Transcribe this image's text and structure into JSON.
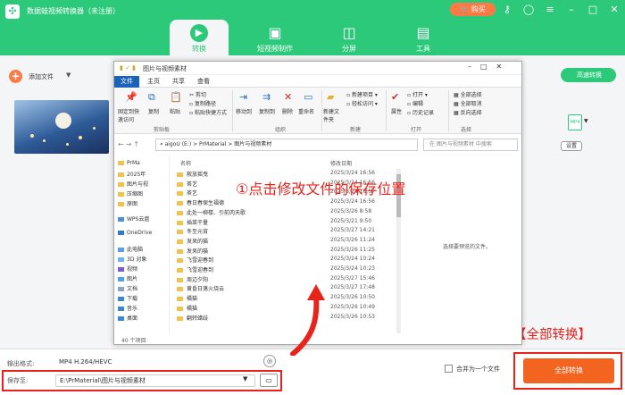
{
  "app": {
    "title": "数据蛙视频转换器（未注册）",
    "buy": "购买"
  },
  "nav": {
    "tabs": [
      {
        "label": "转换"
      },
      {
        "label": "短视频制作"
      },
      {
        "label": "分屏"
      },
      {
        "label": "工具"
      }
    ]
  },
  "toolbar": {
    "add_file": "添加文件",
    "hw_accel": "高速转换"
  },
  "item": {
    "format_badge": "MP4",
    "setting": "设置"
  },
  "bottom": {
    "format_label": "输出格式:",
    "format_value": "MP4 H.264/HEVC",
    "save_label": "保存至:",
    "save_path": "E:\\PrMaterial\\图片与视频素材",
    "merge": "合并为一个文件",
    "convert_all": "全部转换"
  },
  "dialog": {
    "title": "图片与视频素材",
    "tabs": [
      "文件",
      "主页",
      "共享",
      "查看"
    ],
    "ribbon": {
      "pin": "固定到快速访问",
      "copy": "复制",
      "paste": "粘贴",
      "cut": "剪切",
      "copy_path": "复制路径",
      "paste_shortcut": "粘贴快捷方式",
      "move_to": "移动到",
      "copy_to": "复制到",
      "delete": "删除",
      "rename": "重命名",
      "new_folder": "新建文件夹",
      "new_item": "新建项目",
      "easy_access": "轻松访问",
      "properties": "属性",
      "open": "打开",
      "edit": "编辑",
      "history": "历史记录",
      "select_all": "全部选择",
      "select_none": "全部取消",
      "invert": "反向选择",
      "groups": [
        "剪贴板",
        "组织",
        "新建",
        "打开",
        "选择"
      ]
    },
    "path": "« aigoU (E:)  >  PrMaterial  >  图片与视频素材",
    "search": "在 图片与视频素材 中搜索",
    "tree": [
      "PrMa",
      "2025年",
      "图片与视",
      "压缩图",
      "原图",
      "WPS云盘",
      "OneDrive",
      "此电脑",
      "3D 对象",
      "视频",
      "图片",
      "文档",
      "下载",
      "音乐",
      "桌面"
    ],
    "col_name": "名称",
    "col_date": "修改日期",
    "files": [
      {
        "name": "敞放摇曳",
        "date": "2025/3/24 16:56"
      },
      {
        "name": "茶艺",
        "date": "2025/3/24 16:56"
      },
      {
        "name": "茶艺",
        "date": "2025/3/24 16:57"
      },
      {
        "name": "春日春保生福德",
        "date": "2025/3/24 16:56"
      },
      {
        "name": "此处一柳楼、引前肉天歌",
        "date": "2025/3/26 8:58"
      },
      {
        "name": "插菜干量",
        "date": "2025/3/21 9:50"
      },
      {
        "name": "冬至元宵",
        "date": "2025/3/27 14:21"
      },
      {
        "name": "发呆的猫",
        "date": "2025/3/26 11:24"
      },
      {
        "name": "发呆的猫",
        "date": "2025/3/26 11:25"
      },
      {
        "name": "飞雪迎春到",
        "date": "2025/3/24 10:24"
      },
      {
        "name": "飞雪迎春到",
        "date": "2025/3/24 10:23"
      },
      {
        "name": "周边夕阳",
        "date": "2025/3/27 15:46"
      },
      {
        "name": "黄昏日落火烧云",
        "date": "2025/3/27 17:48"
      },
      {
        "name": "橘猫",
        "date": "2025/3/26 10:50"
      },
      {
        "name": "橘猫",
        "date": "2025/3/26 10:49"
      },
      {
        "name": "翻转蜡歧",
        "date": "2025/3/26 10:53"
      }
    ],
    "preview": "选择要预览的文件。",
    "status": "40 个项目"
  },
  "annotations": {
    "step1": "①点击修改文件的保存位置",
    "step2": "②点击【全部转换】"
  }
}
